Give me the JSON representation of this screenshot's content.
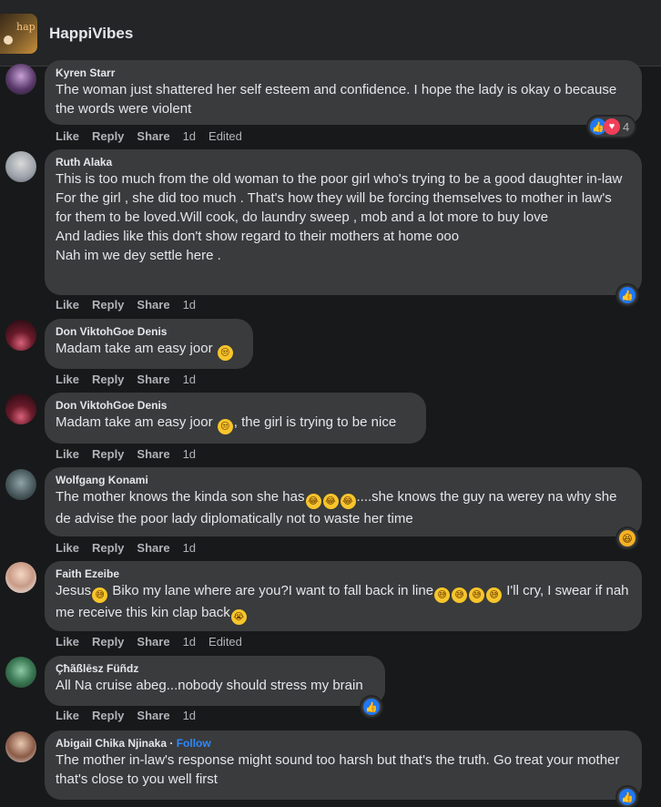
{
  "header": {
    "page_name": "HappiVibes",
    "avatar_text": "hap"
  },
  "colors": {
    "background": "#18191a",
    "bubble": "#3a3b3c",
    "like_blue": "#2078f4",
    "love_red": "#f33e58",
    "follow_blue": "#2d88ff"
  },
  "comments": [
    {
      "author": "Kyren Starr",
      "text": "The woman just shattered her self esteem and confidence. I hope the lady is okay o because the words were violent",
      "actions": {
        "like": "Like",
        "reply": "Reply",
        "share": "Share",
        "time": "1d",
        "edited": "Edited"
      },
      "reactions": {
        "icons": [
          "like-icon",
          "love-icon"
        ],
        "count": "4"
      }
    },
    {
      "author": "Ruth Alaka",
      "text": "This is too much from the old woman to the poor girl who's trying to be a good daughter in-law",
      "text2": "For the girl , she did too much . That's how they will be forcing themselves to mother in law's for them to be loved.Will cook, do laundry sweep , mob and a lot more to buy love",
      "text3": "And ladies like this don't show regard to their mothers at home ooo",
      "text4": "Nah im we dey settle here .",
      "actions": {
        "like": "Like",
        "reply": "Reply",
        "share": "Share",
        "time": "1d"
      },
      "reactions": {
        "icons": [
          "like-icon"
        ]
      }
    },
    {
      "author": "Don ViktohGoe Denis",
      "text": "Madam take am easy joor",
      "actions": {
        "like": "Like",
        "reply": "Reply",
        "share": "Share",
        "time": "1d"
      }
    },
    {
      "author": "Don ViktohGoe Denis",
      "text": "Madam take am easy joor",
      "text_after": ", the girl is trying to be nice",
      "actions": {
        "like": "Like",
        "reply": "Reply",
        "share": "Share",
        "time": "1d"
      }
    },
    {
      "author": "Wolfgang Konami",
      "text": "The mother knows the kinda son she has",
      "text_after": "....she knows the guy na werey na why she de advise the poor lady diplomatically not to waste her time",
      "actions": {
        "like": "Like",
        "reply": "Reply",
        "share": "Share",
        "time": "1d"
      },
      "reactions": {
        "icons": [
          "laugh-icon"
        ]
      }
    },
    {
      "author": "Faith Ezeibe",
      "text": "Jesus",
      "text_mid": " Biko my lane where are you?I want to fall back in line",
      "text_after": " I'll cry, I swear if nah me receive this kin clap back",
      "actions": {
        "like": "Like",
        "reply": "Reply",
        "share": "Share",
        "time": "1d",
        "edited": "Edited"
      }
    },
    {
      "author": "Çħãßlēsz Füñdz",
      "text": "All Na cruise abeg...nobody should stress my brain",
      "actions": {
        "like": "Like",
        "reply": "Reply",
        "share": "Share",
        "time": "1d"
      },
      "reactions": {
        "icons": [
          "like-icon"
        ]
      }
    },
    {
      "author": "Abigail Chika Njinaka",
      "follow": "Follow",
      "separator": " · ",
      "text": "The mother in-law's response might sound too harsh but that's the truth. Go treat your mother that's close to you well first"
    }
  ]
}
